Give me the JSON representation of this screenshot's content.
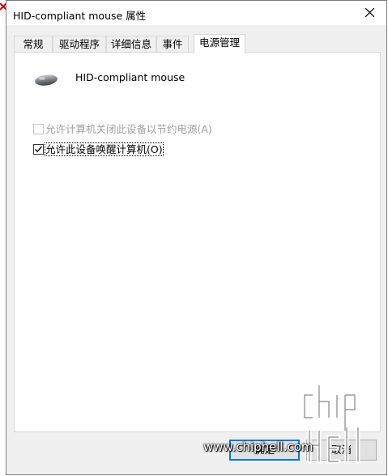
{
  "window": {
    "title": "HID-compliant mouse 属性"
  },
  "tabs": [
    {
      "label": "常规",
      "active": false
    },
    {
      "label": "驱动程序",
      "active": false
    },
    {
      "label": "详细信息",
      "active": false
    },
    {
      "label": "事件",
      "active": false
    },
    {
      "label": "电源管理",
      "active": true
    }
  ],
  "device": {
    "name": "HID-compliant mouse",
    "icon": "mouse-icon"
  },
  "options": [
    {
      "label": "允许计算机关闭此设备以节约电源(A)",
      "checked": false,
      "enabled": false
    },
    {
      "label": "允许此设备唤醒计算机(O)",
      "checked": true,
      "enabled": true
    }
  ],
  "buttons": {
    "ok": "确定",
    "cancel": "取消"
  },
  "watermark": {
    "url": "www.chiphell.com",
    "logo": "chip hell"
  },
  "colors": {
    "dialog_bg": "#f0f0f0",
    "panel_bg": "#ffffff",
    "default_button_border": "#0078d7",
    "disabled_text": "#a0a0a0"
  }
}
